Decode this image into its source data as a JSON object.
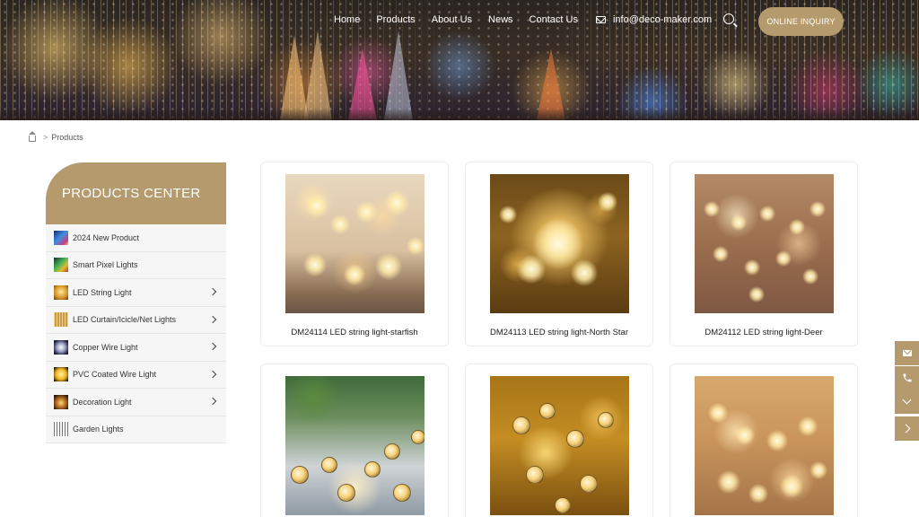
{
  "nav": {
    "items": [
      "Home",
      "Products",
      "About Us",
      "News",
      "Contact Us"
    ],
    "email": "info@deco-maker.com",
    "inquiry_label": "ONLINE INQUIRY"
  },
  "breadcrumb": {
    "sep": ">",
    "current": "Products"
  },
  "sidebar": {
    "title": "PRODUCTS CENTER",
    "items": [
      {
        "label": "2024 New Product",
        "has_children": false
      },
      {
        "label": "Smart Pixel Lights",
        "has_children": false
      },
      {
        "label": "LED String Light",
        "has_children": true
      },
      {
        "label": "LED Curtain/Icicle/Net Lights",
        "has_children": true
      },
      {
        "label": "Copper Wire Light",
        "has_children": true
      },
      {
        "label": "PVC Coated Wire Light",
        "has_children": true
      },
      {
        "label": "Decoration Light",
        "has_children": true
      },
      {
        "label": "Garden Lights",
        "has_children": false
      }
    ]
  },
  "products": [
    {
      "title": "DM24114 LED string light-starfish"
    },
    {
      "title": "DM24113 LED string light-North Star"
    },
    {
      "title": "DM24112 LED string light-Deer"
    },
    {
      "title": ""
    },
    {
      "title": ""
    },
    {
      "title": ""
    }
  ],
  "theme": {
    "accent": "#b59a6d",
    "sidebar_bg": "#f6f6f6"
  },
  "icons": {
    "search": "search-icon",
    "mail": "mail-icon",
    "home": "home-icon",
    "float_mail": "mail-icon",
    "float_phone": "phone-icon",
    "float_down": "chevron-down-icon",
    "float_next": "chevron-right-icon"
  }
}
